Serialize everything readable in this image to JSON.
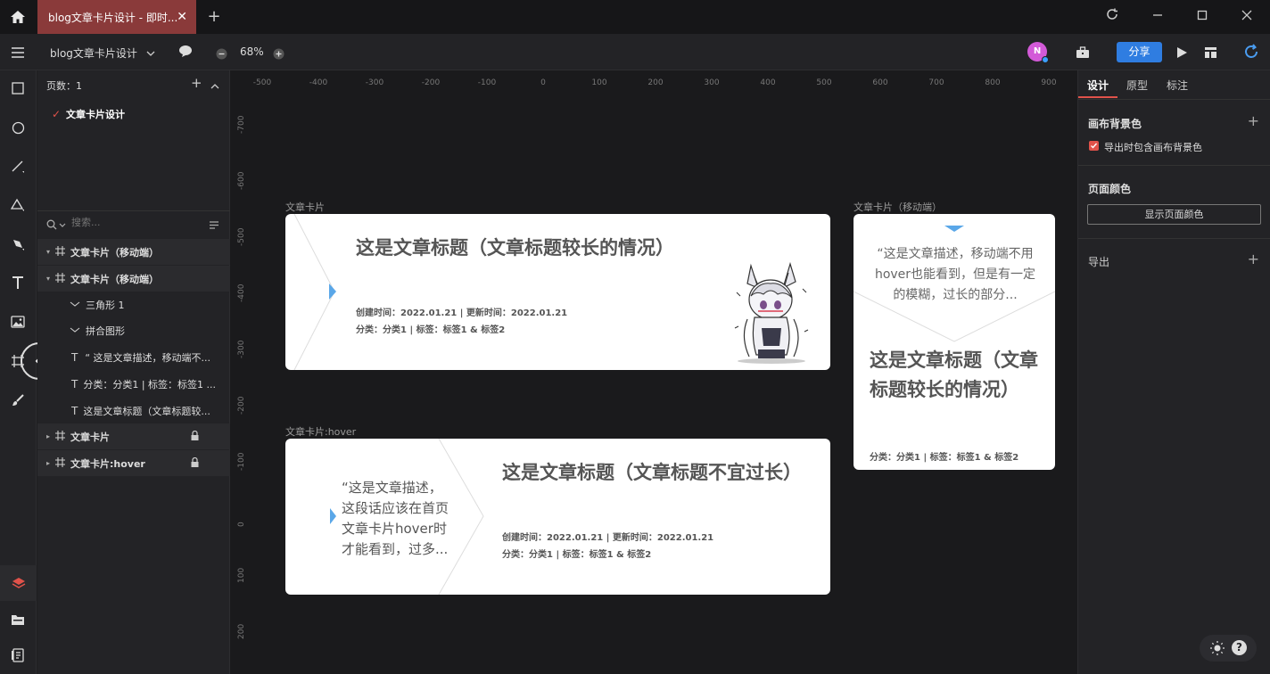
{
  "titlebar": {
    "tab_title": "blog文章卡片设计 - 即时...",
    "close_glyph": "✕",
    "new_tab_glyph": "+"
  },
  "toolbar": {
    "doc_name": "blog文章卡片设计",
    "zoom": "68%",
    "avatar_initial": "N",
    "share_label": "分享"
  },
  "layers": {
    "page_count_label": "页数：1",
    "page_name": "文章卡片设计",
    "search_placeholder": "搜索...",
    "items": [
      {
        "label": "文章卡片（移动端）"
      },
      {
        "label": "文章卡片（移动端）"
      },
      {
        "label": "三角形 1"
      },
      {
        "label": "拼合图形"
      },
      {
        "label": "“ 这是文章描述，移动端不..."
      },
      {
        "label": "分类：分类1 | 标签：标签1 ..."
      },
      {
        "label": "这是文章标题（文章标题较..."
      },
      {
        "label": "文章卡片"
      },
      {
        "label": "文章卡片:hover"
      }
    ]
  },
  "ruler": {
    "top": [
      "-500",
      "-400",
      "-300",
      "-200",
      "-100",
      "0",
      "100",
      "200",
      "300",
      "400",
      "500",
      "600",
      "700",
      "800",
      "900"
    ],
    "left": [
      "-700",
      "-600",
      "-500",
      "-400",
      "-300",
      "-200",
      "-100",
      "0",
      "100",
      "200"
    ]
  },
  "canvas": {
    "card1": {
      "frame_label": "文章卡片",
      "title": "这是文章标题（文章标题较长的情况）",
      "dates": "创建时间：2022.01.21 | 更新时间：2022.01.21",
      "tags": "分类：分类1 | 标签：标签1 & 标签2"
    },
    "card2": {
      "frame_label": "文章卡片:hover",
      "desc": "“这是文章描述，这段话应该在首页文章卡片hover时才能看到，过多...",
      "title": "这是文章标题（文章标题不宜过长）",
      "dates": "创建时间：2022.01.21 | 更新时间：2022.01.21",
      "tags": "分类：分类1 | 标签：标签1 & 标签2"
    },
    "card3": {
      "frame_label": "文章卡片（移动端）",
      "desc": "“这是文章描述，移动端不用hover也能看到，但是有一定的模糊，过长的部分...",
      "title": "这是文章标题（文章标题较长的情况）",
      "tags": "分类：分类1 | 标签：标签1 & 标签2"
    }
  },
  "rightpanel": {
    "tabs": [
      "设计",
      "原型",
      "标注"
    ],
    "canvas_bg_label": "画布背景色",
    "export_bg_checkbox_label": "导出时包含画布背景色",
    "page_color_label": "页面颜色",
    "show_page_color_button": "显示页面颜色",
    "export_label": "导出"
  },
  "colors": {
    "accent": "#2f7de1",
    "tab_active": "#8a3a3a",
    "card_bg": "#ffffff",
    "triangle": "#5aa7e8"
  }
}
